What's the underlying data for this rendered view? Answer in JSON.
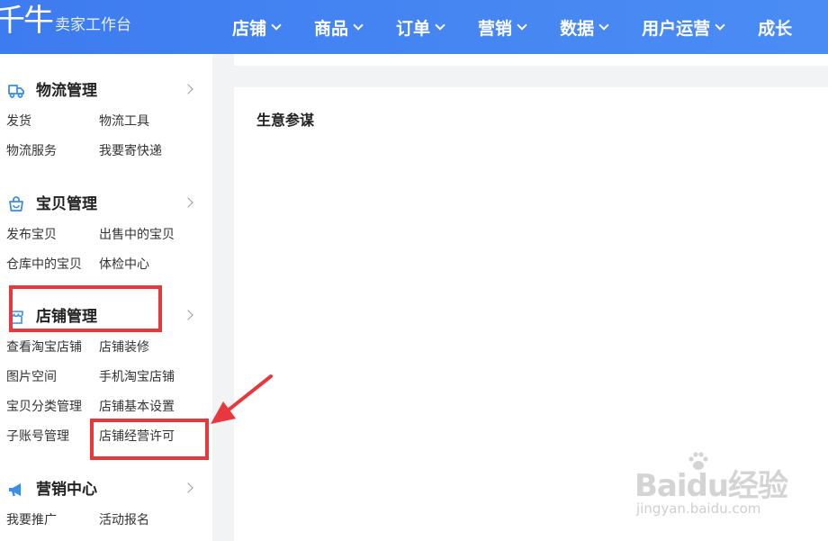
{
  "header": {
    "brand_glyph": "千牛",
    "brand_subtitle": "卖家工作台",
    "nav": [
      "店铺",
      "商品",
      "订单",
      "营销",
      "数据",
      "用户运营",
      "成长"
    ]
  },
  "sidebar": {
    "sections": [
      {
        "title": "物流管理",
        "icon": "truck-icon",
        "links": [
          "发货",
          "物流工具",
          "物流服务",
          "我要寄快递"
        ]
      },
      {
        "title": "宝贝管理",
        "icon": "shopping-bag-icon",
        "links": [
          "发布宝贝",
          "出售中的宝贝",
          "仓库中的宝贝",
          "体检中心"
        ]
      },
      {
        "title": "店铺管理",
        "icon": "store-icon",
        "links": [
          "查看淘宝店铺",
          "店铺装修",
          "图片空间",
          "手机淘宝店铺",
          "宝贝分类管理",
          "店铺基本设置",
          "子账号管理",
          "店铺经营许可"
        ]
      },
      {
        "title": "营销中心",
        "icon": "megaphone-icon",
        "links": [
          "我要推广",
          "活动报名"
        ]
      }
    ]
  },
  "main": {
    "panel_title": "生意参谋"
  },
  "watermark": {
    "main": "Baidu经验",
    "sub": "jingyan.baidu.com"
  },
  "colors": {
    "topbar": "#4585f2",
    "icon": "#3c8ce8",
    "annotation": "#e8383d",
    "background": "#f2f3f5"
  }
}
